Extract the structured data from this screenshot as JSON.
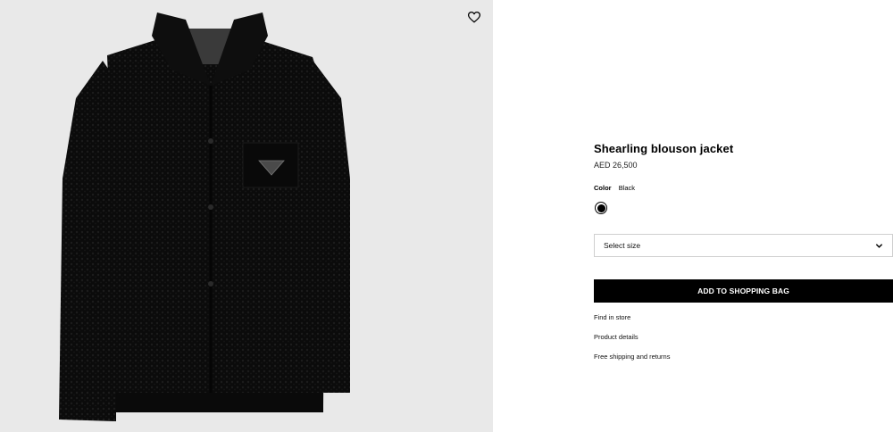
{
  "product": {
    "name": "Shearling blouson jacket",
    "price": "AED 26,500",
    "color_label": "Color",
    "color_value": "Black",
    "swatch_color": "#000000",
    "image": "black-shearling-jacket-image"
  },
  "size_select": {
    "label": "Select size"
  },
  "actions": {
    "add_to_bag": "ADD TO SHOPPING BAG"
  },
  "links": {
    "find_in_store": "Find in store",
    "product_details": "Product details",
    "shipping": "Free shipping and returns"
  },
  "icons": {
    "wishlist": "heart-icon",
    "dropdown": "chevron-down-icon"
  },
  "colors": {
    "image_background": "#e9e9e9",
    "button_background": "#000000",
    "button_text": "#ffffff"
  }
}
